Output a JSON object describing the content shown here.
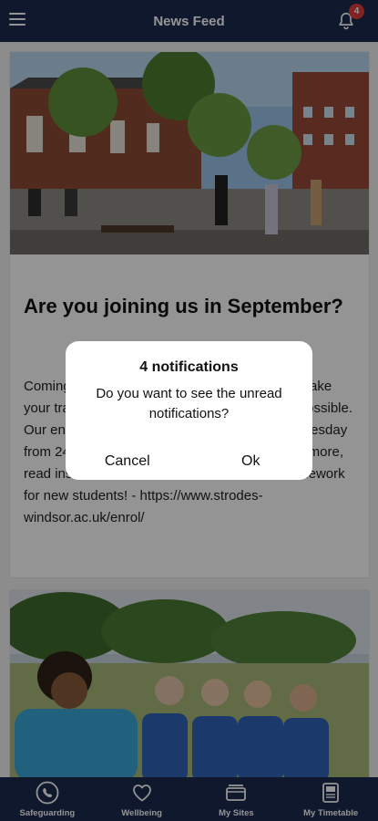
{
  "header": {
    "title": "News Feed",
    "menu_icon": "hamburger-menu-icon",
    "bell_icon": "bell-icon",
    "notification_count": "4"
  },
  "feed": {
    "posts": [
      {
        "title": "Are you joining us in September?",
        "body": "Coming to Strodes in September? We aim to make your transition to Strodes College as easy as possible. Our enrolment for September 2023 starts on Tuesday from 24th to 25th August. Click here to find out more, read instructions and access our Summer Homework for new students! - https://www.strodes-windsor.ac.uk/enrol/"
      }
    ]
  },
  "dialog": {
    "title": "4 notifications",
    "message": "Do you want to see the unread notifications?",
    "cancel_label": "Cancel",
    "ok_label": "Ok"
  },
  "bottom_nav": {
    "items": [
      {
        "label": "Safeguarding",
        "icon": "phone-icon"
      },
      {
        "label": "Wellbeing",
        "icon": "heart-icon"
      },
      {
        "label": "My Sites",
        "icon": "sites-icon"
      },
      {
        "label": "My Timetable",
        "icon": "timetable-icon"
      }
    ]
  },
  "colors": {
    "brand": "#1b2a4f",
    "badge": "#e23b3b"
  }
}
